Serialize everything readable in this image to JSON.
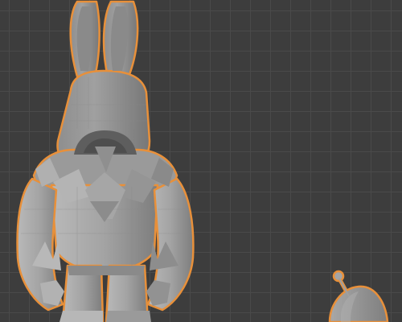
{
  "viewport": {
    "background": "#3d3d3d",
    "grid_color": "#4a4a4a",
    "selection_outline_color": "#e8903a",
    "mesh_color": "#9e9e9e"
  },
  "objects": [
    {
      "name": "bunny-hooded-character",
      "selected": true
    },
    {
      "name": "egg-creature-with-antenna",
      "selected": true
    }
  ]
}
